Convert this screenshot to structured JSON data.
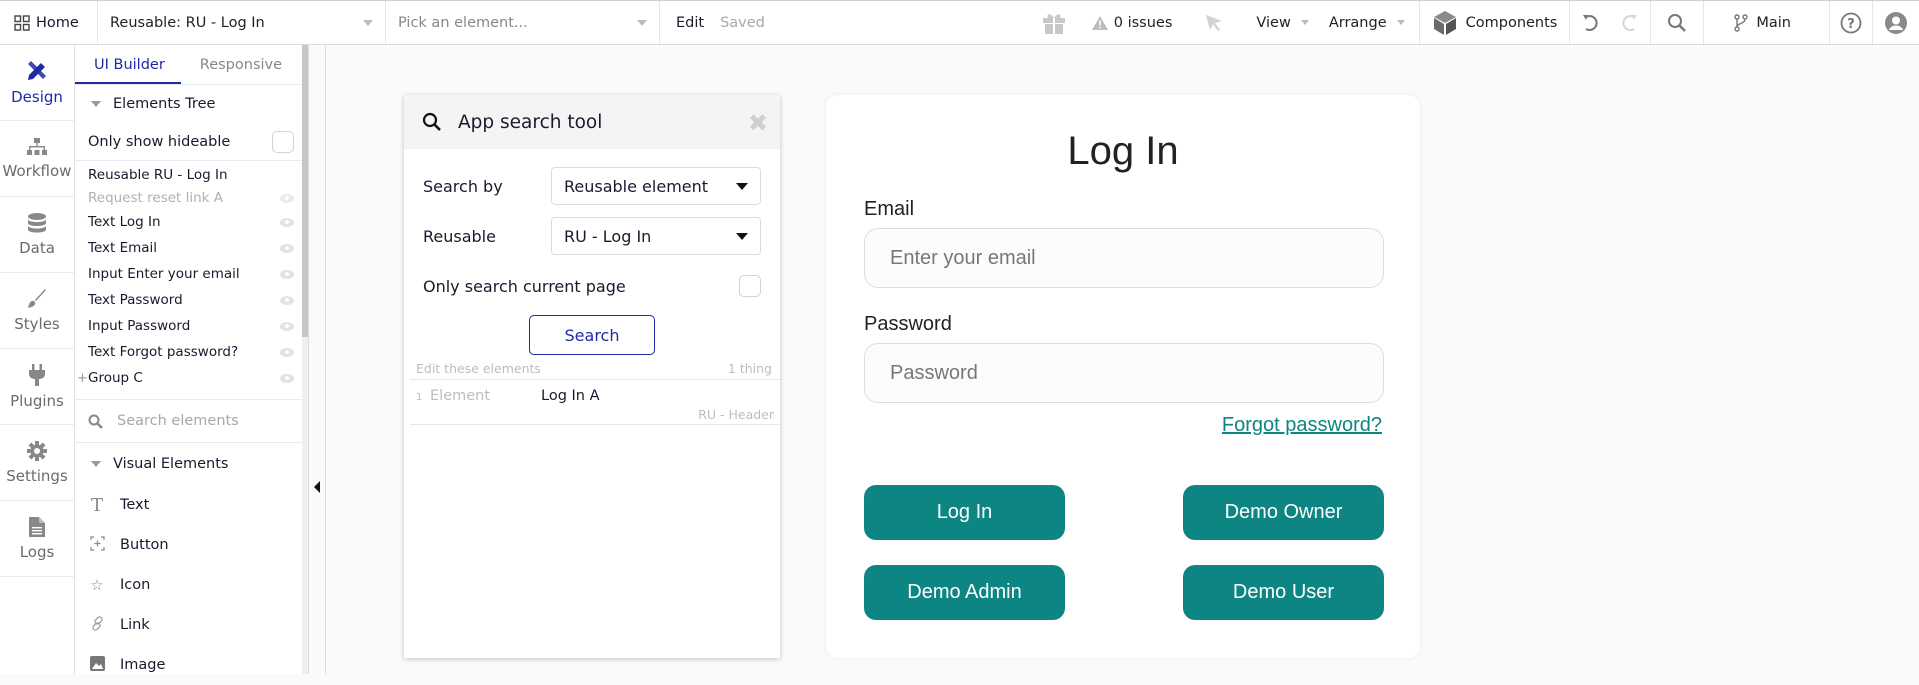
{
  "topbar": {
    "home_label": "Home",
    "page_select": "Reusable: RU - Log In",
    "element_picker_placeholder": "Pick an element...",
    "edit_label": "Edit",
    "saved_label": "Saved",
    "issues_label": "0 issues",
    "view_label": "View",
    "arrange_label": "Arrange",
    "components_label": "Components",
    "branch_label": "Main"
  },
  "rail": {
    "items": [
      {
        "label": "Design",
        "icon": "pencil-ruler-icon",
        "active": true
      },
      {
        "label": "Workflow",
        "icon": "sitemap-icon"
      },
      {
        "label": "Data",
        "icon": "database-icon"
      },
      {
        "label": "Styles",
        "icon": "brush-icon"
      },
      {
        "label": "Plugins",
        "icon": "plug-icon"
      },
      {
        "label": "Settings",
        "icon": "gear-icon"
      },
      {
        "label": "Logs",
        "icon": "file-icon"
      }
    ]
  },
  "panel": {
    "tabs": [
      "UI Builder",
      "Responsive"
    ],
    "elements_tree_title": "Elements Tree",
    "only_show_hideable": "Only show hideable",
    "tree": [
      {
        "label": "Reusable RU - Log In"
      },
      {
        "label": "Request reset link A",
        "dim": true
      },
      {
        "label": "Text Log In"
      },
      {
        "label": "Text Email"
      },
      {
        "label": "Input Enter your email"
      },
      {
        "label": "Text Password"
      },
      {
        "label": "Input Password"
      },
      {
        "label": "Text Forgot password?"
      },
      {
        "label": "Group C",
        "expandable": true
      }
    ],
    "search_placeholder": "Search elements",
    "visual_elements_title": "Visual Elements",
    "visual_elements": [
      {
        "label": "Text",
        "icon": "text-icon"
      },
      {
        "label": "Button",
        "icon": "button-icon"
      },
      {
        "label": "Icon",
        "icon": "star-icon"
      },
      {
        "label": "Link",
        "icon": "link-icon"
      },
      {
        "label": "Image",
        "icon": "image-icon"
      }
    ]
  },
  "search_tool": {
    "title": "App search tool",
    "search_by_label": "Search by",
    "search_by_value": "Reusable element",
    "reusable_label": "Reusable",
    "reusable_value": "RU - Log In",
    "only_current_page_label": "Only search current page",
    "search_button": "Search",
    "edit_these": "Edit these elements",
    "count": "1 thing",
    "results": [
      {
        "num": "1",
        "type": "Element",
        "name": "Log In A",
        "context": "RU - Header"
      }
    ]
  },
  "login": {
    "title": "Log In",
    "email_label": "Email",
    "email_placeholder": "Enter your email",
    "password_label": "Password",
    "password_placeholder": "Password",
    "forgot": "Forgot password?",
    "buttons": [
      "Log In",
      "Demo Owner",
      "Demo Admin",
      "Demo User"
    ],
    "accent": "#0d8582"
  }
}
